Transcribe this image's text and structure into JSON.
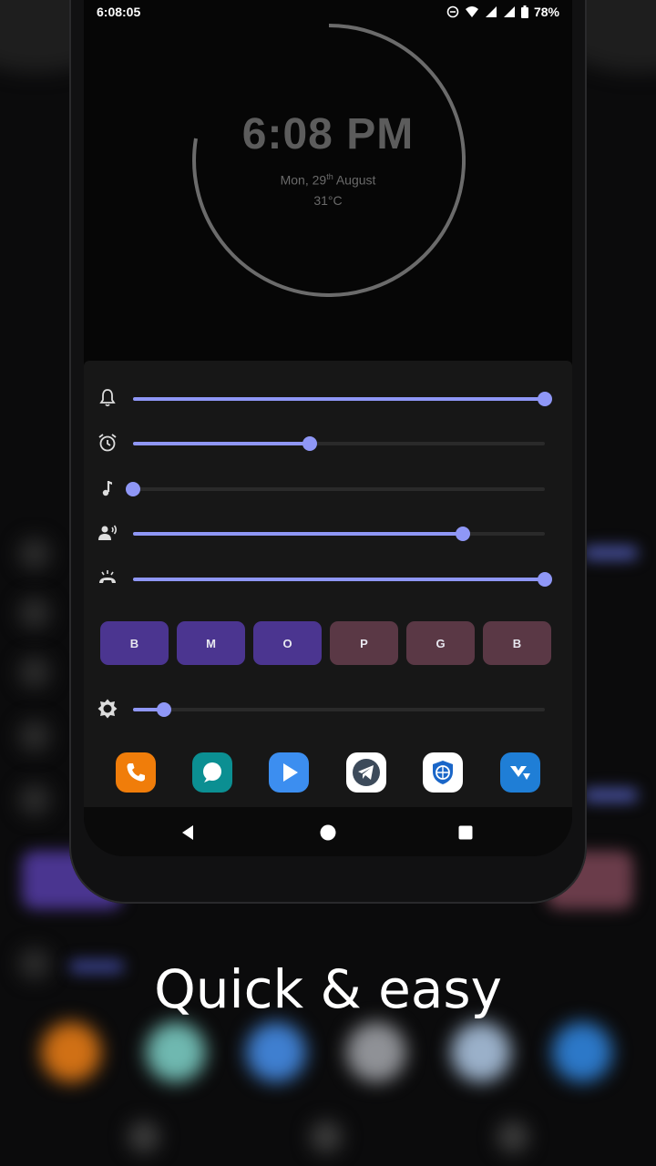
{
  "status_bar": {
    "time": "6:08:05",
    "battery": "78%"
  },
  "clock": {
    "time": "6:08 PM",
    "date_prefix": "Mon, 29",
    "date_sup": "th",
    "date_suffix": " August",
    "temperature": "31°C"
  },
  "sliders": [
    {
      "name": "ringtone",
      "icon": "bell-icon",
      "level": 1.0
    },
    {
      "name": "alarm",
      "icon": "alarm-clock-icon",
      "level": 0.43
    },
    {
      "name": "media",
      "icon": "music-note-icon",
      "level": 0.0
    },
    {
      "name": "voice-call",
      "icon": "voice-call-icon",
      "level": 0.8
    },
    {
      "name": "notification",
      "icon": "ringer-icon",
      "level": 1.0
    }
  ],
  "mode_buttons": [
    {
      "label": "B",
      "color": "#4b3590"
    },
    {
      "label": "M",
      "color": "#4b3590"
    },
    {
      "label": "O",
      "color": "#4b3590"
    },
    {
      "label": "P",
      "color": "#5a3845"
    },
    {
      "label": "G",
      "color": "#5a3845"
    },
    {
      "label": "B",
      "color": "#5a3845"
    }
  ],
  "brightness": {
    "icon": "brightness-icon",
    "level": 0.075
  },
  "dock_apps": [
    {
      "icon": "phone-app-icon",
      "color": "#f07d0a"
    },
    {
      "icon": "messages-app-icon",
      "color": "#0b8f92"
    },
    {
      "icon": "play-app-icon",
      "color": "#3c8ef0"
    },
    {
      "icon": "telegram-app-icon",
      "color": "#ffffff"
    },
    {
      "icon": "browser-shield-app-icon",
      "color": "#ffffff"
    },
    {
      "icon": "mx-player-app-icon",
      "color": "#1f7ed6"
    }
  ],
  "accent_color": "#8f97f6",
  "caption": "Quick & easy"
}
